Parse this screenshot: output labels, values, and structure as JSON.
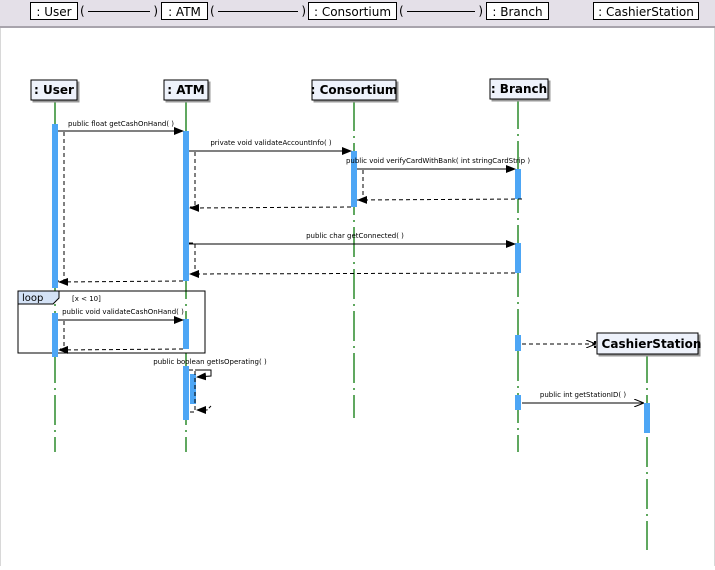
{
  "header_bar": {
    "lifelines": [
      {
        "id": "user",
        "label": ": User"
      },
      {
        "id": "atm",
        "label": ": ATM"
      },
      {
        "id": "consortium",
        "label": ": Consortium"
      },
      {
        "id": "branch",
        "label": ": Branch"
      },
      {
        "id": "cashier",
        "label": ": CashierStation"
      }
    ],
    "connector_glyph_left": "(",
    "connector_glyph_right": ")"
  },
  "diagram": {
    "colors": {
      "lifeline": "#0a7a0a",
      "activation": "#4da6f5",
      "header_fill": "#eef2fb",
      "loop_tab_fill": "#d4e2f6"
    },
    "lifelines": [
      {
        "id": "user",
        "label": ": User"
      },
      {
        "id": "atm",
        "label": ": ATM"
      },
      {
        "id": "consortium",
        "label": ": Consortium"
      },
      {
        "id": "branch",
        "label": ": Branch"
      },
      {
        "id": "cashier",
        "label": ": CashierStation"
      }
    ],
    "messages": [
      {
        "from": "user",
        "to": "atm",
        "label": "public float  getCashOnHand(  )",
        "kind": "call"
      },
      {
        "from": "atm",
        "to": "consortium",
        "label": "private void  validateAccountInfo(  )",
        "kind": "call"
      },
      {
        "from": "consortium",
        "to": "branch",
        "label": "public void  verifyCardWithBank(  int stringCardStrip )",
        "kind": "call"
      },
      {
        "from": "branch",
        "to": "consortium",
        "label": "",
        "kind": "return"
      },
      {
        "from": "consortium",
        "to": "atm",
        "label": "",
        "kind": "return"
      },
      {
        "from": "atm",
        "to": "branch",
        "label": "public char  getConnected(  )",
        "kind": "call"
      },
      {
        "from": "branch",
        "to": "atm",
        "label": "",
        "kind": "return"
      },
      {
        "from": "atm",
        "to": "user",
        "label": "",
        "kind": "return"
      },
      {
        "from": "user",
        "to": "atm",
        "label": "public void  validateCashOnHand(  )",
        "kind": "call"
      },
      {
        "from": "atm",
        "to": "user",
        "label": "",
        "kind": "return"
      },
      {
        "from": "atm",
        "to": "atm",
        "label": "public boolean  getIsOperating(  )",
        "kind": "self"
      },
      {
        "from": "branch",
        "to": "cashier",
        "label": "",
        "kind": "create"
      },
      {
        "from": "branch",
        "to": "cashier",
        "label": "public int  getStationID(  )",
        "kind": "call"
      }
    ],
    "fragments": [
      {
        "operator": "loop",
        "guard": "[x < 10]"
      }
    ]
  }
}
